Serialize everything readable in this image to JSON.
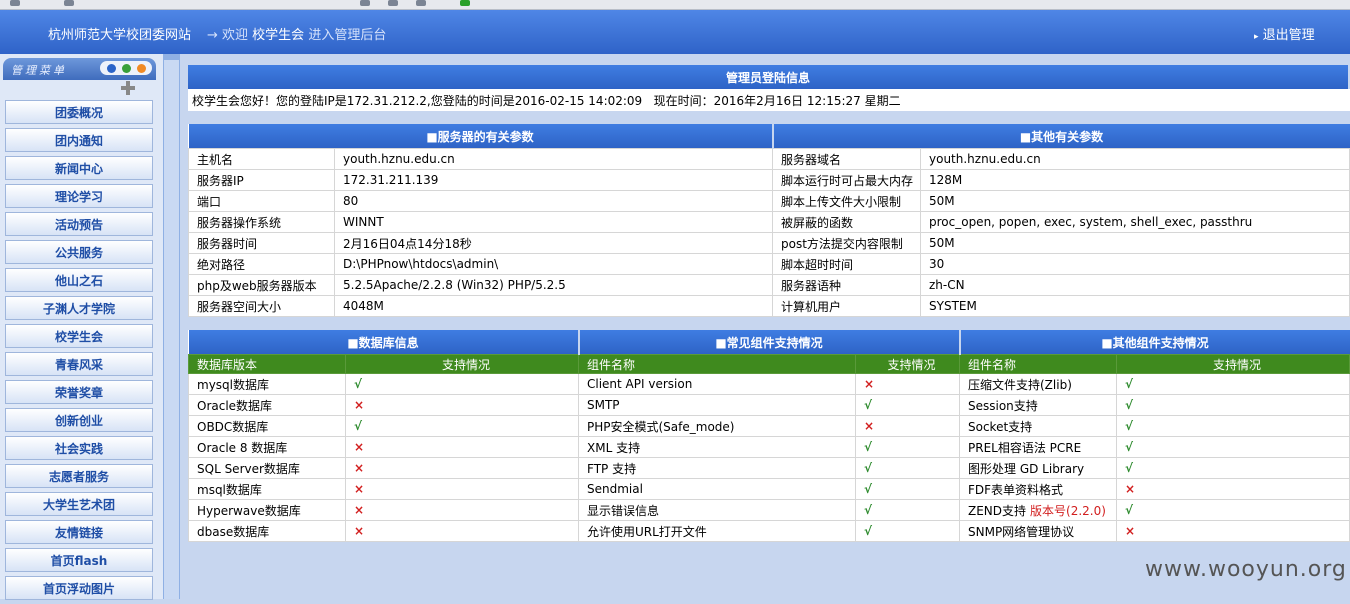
{
  "header": {
    "site_name": "杭州师范大学校团委网站",
    "welcome_prefix": "→ 欢迎",
    "user": "校学生会",
    "welcome_suffix": "进入管理后台",
    "logout": "退出管理"
  },
  "menu": {
    "title": "管理菜单",
    "items": [
      "团委概况",
      "团内通知",
      "新闻中心",
      "理论学习",
      "活动预告",
      "公共服务",
      "他山之石",
      "子渊人才学院",
      "校学生会",
      "青春风采",
      "荣誉奖章",
      "创新创业",
      "社会实践",
      "志愿者服务",
      "大学生艺术团",
      "友情链接",
      "首页flash",
      "首页浮动图片"
    ]
  },
  "login": {
    "title": "管理员登陆信息",
    "text": "校学生会您好！您的登陆IP是172.31.212.2,您登陆的时间是2016-02-15 14:02:09   现在时间：2016年2月16日 12:15:27 星期二"
  },
  "server": {
    "left_title": "■服务器的有关参数",
    "right_title": "■其他有关参数",
    "left": [
      [
        "主机名",
        "youth.hznu.edu.cn"
      ],
      [
        "服务器IP",
        "172.31.211.139"
      ],
      [
        "端口",
        "80"
      ],
      [
        "服务器操作系统",
        "WINNT"
      ],
      [
        "服务器时间",
        "2月16日04点14分18秒"
      ],
      [
        "绝对路径",
        "D:\\PHPnow\\htdocs\\admin\\"
      ],
      [
        "php及web服务器版本",
        "5.2.5Apache/2.2.8 (Win32) PHP/5.2.5"
      ],
      [
        "服务器空间大小",
        "4048M"
      ]
    ],
    "right": [
      [
        "服务器域名",
        "youth.hznu.edu.cn"
      ],
      [
        "脚本运行时可占最大内存",
        "128M"
      ],
      [
        "脚本上传文件大小限制",
        "50M"
      ],
      [
        "被屏蔽的函数",
        "proc_open, popen, exec, system, shell_exec, passthru"
      ],
      [
        "post方法提交内容限制",
        "50M"
      ],
      [
        "脚本超时时间",
        "30"
      ],
      [
        "服务器语种",
        "zh-CN"
      ],
      [
        "计算机用户",
        "SYSTEM"
      ]
    ]
  },
  "components": {
    "db_title": "■数据库信息",
    "common_title": "■常见组件支持情况",
    "other_title": "■其他组件支持情况",
    "db_h1": "数据库版本",
    "db_h2": "支持情况",
    "common_h1": "组件名称",
    "common_h2": "支持情况",
    "other_h1": "组件名称",
    "other_h2": "支持情况",
    "yes_glyph": "√",
    "no_glyph": "×",
    "rows": [
      {
        "db": "mysql数据库",
        "db_ok": true,
        "common": "Client API version",
        "common_ok": false,
        "other": "压缩文件支持(Zlib)",
        "other_ok": true
      },
      {
        "db": "Oracle数据库",
        "db_ok": false,
        "common": "SMTP",
        "common_ok": true,
        "other": "Session支持",
        "other_ok": true
      },
      {
        "db": "OBDC数据库",
        "db_ok": true,
        "common": "PHP安全模式(Safe_mode)",
        "common_ok": false,
        "other": "Socket支持",
        "other_ok": true
      },
      {
        "db": "Oracle 8 数据库",
        "db_ok": false,
        "common": "XML 支持",
        "common_ok": true,
        "other": "PREL相容语法 PCRE",
        "other_ok": true
      },
      {
        "db": "SQL Server数据库",
        "db_ok": false,
        "common": "FTP 支持",
        "common_ok": true,
        "other": "图形处理 GD Library",
        "other_ok": true
      },
      {
        "db": "msql数据库",
        "db_ok": false,
        "common": "Sendmial",
        "common_ok": true,
        "other": "FDF表单资料格式",
        "other_ok": false
      },
      {
        "db": "Hyperwave数据库",
        "db_ok": false,
        "common": "显示错误信息",
        "common_ok": true,
        "other": "ZEND支持",
        "other_extra": "版本号(2.2.0)",
        "other_ok": true
      },
      {
        "db": "dbase数据库",
        "db_ok": false,
        "common": "允许使用URL打开文件",
        "common_ok": true,
        "other": "SNMP网络管理协议",
        "other_ok": false
      }
    ]
  },
  "watermark": "www.wooyun.org"
}
